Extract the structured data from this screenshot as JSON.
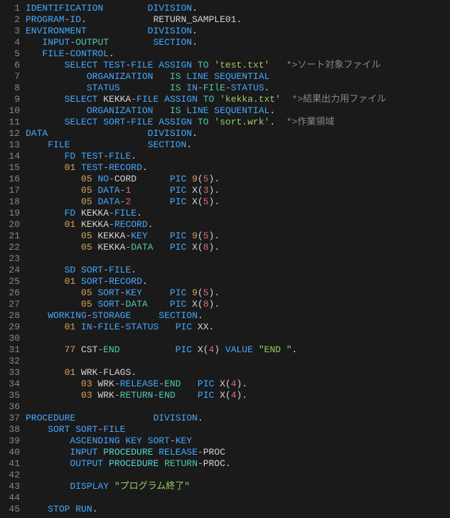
{
  "lines": [
    [
      [
        "kw",
        "IDENTIFICATION"
      ],
      [
        "pl",
        "        "
      ],
      [
        "kw",
        "DIVISION"
      ],
      [
        "pl",
        "."
      ]
    ],
    [
      [
        "kw",
        "PROGRAM"
      ],
      [
        "pk",
        "-"
      ],
      [
        "kw",
        "ID"
      ],
      [
        "pl",
        "."
      ],
      [
        "pl",
        "            RETURN_SAMPLE01."
      ]
    ],
    [
      [
        "kw",
        "ENVIRONMENT"
      ],
      [
        "pl",
        "           "
      ],
      [
        "kw",
        "DIVISION"
      ],
      [
        "pl",
        "."
      ]
    ],
    [
      [
        "kw",
        "   INPUT"
      ],
      [
        "pk",
        "-"
      ],
      [
        "teal",
        "OUTPUT"
      ],
      [
        "pl",
        "        "
      ],
      [
        "kw",
        "SECTION"
      ],
      [
        "pl",
        "."
      ]
    ],
    [
      [
        "kw",
        "   FILE"
      ],
      [
        "pk",
        "-"
      ],
      [
        "kw",
        "CONTROL"
      ],
      [
        "pl",
        "."
      ]
    ],
    [
      [
        "pl",
        "       "
      ],
      [
        "kw",
        "SELECT"
      ],
      [
        "pl",
        " "
      ],
      [
        "kw",
        "TEST"
      ],
      [
        "pk",
        "-"
      ],
      [
        "kw",
        "FILE "
      ],
      [
        "kw",
        "ASSIGN "
      ],
      [
        "teal",
        "TO"
      ],
      [
        "pl",
        " "
      ],
      [
        "str",
        "'test.txt'"
      ],
      [
        "pl",
        "   "
      ],
      [
        "cm",
        "*>ソート対象ファイル"
      ]
    ],
    [
      [
        "pl",
        "           "
      ],
      [
        "kw",
        "ORGANIZATION"
      ],
      [
        "pl",
        "   "
      ],
      [
        "teal",
        "IS"
      ],
      [
        "pl",
        " "
      ],
      [
        "kw",
        "LINE "
      ],
      [
        "kw",
        "SEQUENTIAL"
      ]
    ],
    [
      [
        "pl",
        "           "
      ],
      [
        "kw",
        "STATUS"
      ],
      [
        "pl",
        "         "
      ],
      [
        "teal",
        "IS"
      ],
      [
        "pl",
        " "
      ],
      [
        "kw",
        "IN"
      ],
      [
        "pk",
        "-"
      ],
      [
        "teal",
        "FIlE"
      ],
      [
        "pk",
        "-"
      ],
      [
        "kw",
        "STATUS"
      ],
      [
        "pl",
        "."
      ]
    ],
    [
      [
        "pl",
        "       "
      ],
      [
        "kw",
        "SELECT"
      ],
      [
        "pl",
        " KEKKA"
      ],
      [
        "pk",
        "-"
      ],
      [
        "kw",
        "FILE "
      ],
      [
        "kw",
        "ASSIGN "
      ],
      [
        "teal",
        "TO"
      ],
      [
        "pl",
        " "
      ],
      [
        "str",
        "'kekka.txt'"
      ],
      [
        "pl",
        "  "
      ],
      [
        "cm",
        "*>結果出力用ファイル"
      ]
    ],
    [
      [
        "pl",
        "           "
      ],
      [
        "kw",
        "ORGANIZATION"
      ],
      [
        "pl",
        "   "
      ],
      [
        "teal",
        "IS"
      ],
      [
        "pl",
        " "
      ],
      [
        "kw",
        "LINE "
      ],
      [
        "kw",
        "SEQUENTIAL"
      ],
      [
        "pl",
        "."
      ]
    ],
    [
      [
        "pl",
        "       "
      ],
      [
        "kw",
        "SELECT "
      ],
      [
        "kw",
        "SORT"
      ],
      [
        "pk",
        "-"
      ],
      [
        "kw",
        "FILE "
      ],
      [
        "kw",
        "ASSIGN "
      ],
      [
        "teal",
        "TO"
      ],
      [
        "pl",
        " "
      ],
      [
        "str",
        "'sort.wrk'"
      ],
      [
        "pl",
        ".  "
      ],
      [
        "cm",
        "*>作業領域"
      ]
    ],
    [
      [
        "kw",
        "DATA"
      ],
      [
        "pl",
        "                  "
      ],
      [
        "kw",
        "DIVISION"
      ],
      [
        "pl",
        "."
      ]
    ],
    [
      [
        "pl",
        "    "
      ],
      [
        "kw",
        "FILE"
      ],
      [
        "pl",
        "              "
      ],
      [
        "kw",
        "SECTION"
      ],
      [
        "pl",
        "."
      ]
    ],
    [
      [
        "pl",
        "       "
      ],
      [
        "kw",
        "FD "
      ],
      [
        "kw",
        "TEST"
      ],
      [
        "pk",
        "-"
      ],
      [
        "kw",
        "FILE"
      ],
      [
        "pl",
        "."
      ]
    ],
    [
      [
        "pl",
        "       "
      ],
      [
        "ol",
        "01"
      ],
      [
        "pl",
        " "
      ],
      [
        "kw",
        "TEST"
      ],
      [
        "pk",
        "-"
      ],
      [
        "kw",
        "RECORD"
      ],
      [
        "pl",
        "."
      ]
    ],
    [
      [
        "pl",
        "          "
      ],
      [
        "ol",
        "05"
      ],
      [
        "pl",
        " "
      ],
      [
        "kw",
        "NO"
      ],
      [
        "pk",
        "-"
      ],
      [
        "pl",
        "CORD      "
      ],
      [
        "kw",
        "PIC"
      ],
      [
        "pl",
        " "
      ],
      [
        "ol",
        "9"
      ],
      [
        "pl",
        "("
      ],
      [
        "num",
        "5"
      ],
      [
        "pl",
        ")."
      ]
    ],
    [
      [
        "pl",
        "          "
      ],
      [
        "ol",
        "05"
      ],
      [
        "pl",
        " "
      ],
      [
        "kw",
        "DATA"
      ],
      [
        "pk",
        "-"
      ],
      [
        "num",
        "1"
      ],
      [
        "pl",
        "       "
      ],
      [
        "kw",
        "PIC"
      ],
      [
        "pl",
        " X("
      ],
      [
        "num",
        "3"
      ],
      [
        "pl",
        ")."
      ]
    ],
    [
      [
        "pl",
        "          "
      ],
      [
        "ol",
        "05"
      ],
      [
        "pl",
        " "
      ],
      [
        "kw",
        "DATA"
      ],
      [
        "pk",
        "-"
      ],
      [
        "num",
        "2"
      ],
      [
        "pl",
        "       "
      ],
      [
        "kw",
        "PIC"
      ],
      [
        "pl",
        " X("
      ],
      [
        "num",
        "5"
      ],
      [
        "pl",
        ")."
      ]
    ],
    [
      [
        "pl",
        "       "
      ],
      [
        "kw",
        "FD"
      ],
      [
        "pl",
        " KEKKA"
      ],
      [
        "pk",
        "-"
      ],
      [
        "kw",
        "FILE"
      ],
      [
        "pl",
        "."
      ]
    ],
    [
      [
        "pl",
        "       "
      ],
      [
        "ol",
        "01"
      ],
      [
        "pl",
        " KEKKA"
      ],
      [
        "pk",
        "-"
      ],
      [
        "kw",
        "RECORD"
      ],
      [
        "pl",
        "."
      ]
    ],
    [
      [
        "pl",
        "          "
      ],
      [
        "ol",
        "05"
      ],
      [
        "pl",
        " KEKKA"
      ],
      [
        "pk",
        "-"
      ],
      [
        "kw",
        "KEY"
      ],
      [
        "pl",
        "    "
      ],
      [
        "kw",
        "PIC"
      ],
      [
        "pl",
        " "
      ],
      [
        "ol",
        "9"
      ],
      [
        "pl",
        "("
      ],
      [
        "num",
        "5"
      ],
      [
        "pl",
        ")."
      ]
    ],
    [
      [
        "pl",
        "          "
      ],
      [
        "ol",
        "05"
      ],
      [
        "pl",
        " KEKKA"
      ],
      [
        "pk",
        "-"
      ],
      [
        "teal",
        "DATA"
      ],
      [
        "pl",
        "   "
      ],
      [
        "kw",
        "PIC"
      ],
      [
        "pl",
        " X("
      ],
      [
        "num",
        "8"
      ],
      [
        "pl",
        ")."
      ]
    ],
    [
      [
        "pl",
        ""
      ]
    ],
    [
      [
        "pl",
        "       "
      ],
      [
        "kw",
        "SD "
      ],
      [
        "kw",
        "SORT"
      ],
      [
        "pk",
        "-"
      ],
      [
        "kw",
        "FILE"
      ],
      [
        "pl",
        "."
      ]
    ],
    [
      [
        "pl",
        "       "
      ],
      [
        "ol",
        "01"
      ],
      [
        "pl",
        " "
      ],
      [
        "kw",
        "SORT"
      ],
      [
        "pk",
        "-"
      ],
      [
        "kw",
        "RECORD"
      ],
      [
        "pl",
        "."
      ]
    ],
    [
      [
        "pl",
        "          "
      ],
      [
        "ol",
        "05"
      ],
      [
        "pl",
        " "
      ],
      [
        "kw",
        "SORT"
      ],
      [
        "pk",
        "-"
      ],
      [
        "kw",
        "KEY"
      ],
      [
        "pl",
        "     "
      ],
      [
        "kw",
        "PIC"
      ],
      [
        "pl",
        " "
      ],
      [
        "ol",
        "9"
      ],
      [
        "pl",
        "("
      ],
      [
        "num",
        "5"
      ],
      [
        "pl",
        ")."
      ]
    ],
    [
      [
        "pl",
        "          "
      ],
      [
        "ol",
        "05"
      ],
      [
        "pl",
        " "
      ],
      [
        "kw",
        "SORT"
      ],
      [
        "pk",
        "-"
      ],
      [
        "teal",
        "DATA"
      ],
      [
        "pl",
        "    "
      ],
      [
        "kw",
        "PIC"
      ],
      [
        "pl",
        " X("
      ],
      [
        "num",
        "8"
      ],
      [
        "pl",
        ")."
      ]
    ],
    [
      [
        "kw",
        "    WORKING"
      ],
      [
        "pk",
        "-"
      ],
      [
        "kw",
        "STORAGE"
      ],
      [
        "pl",
        "     "
      ],
      [
        "kw",
        "SECTION"
      ],
      [
        "pl",
        "."
      ]
    ],
    [
      [
        "pl",
        "       "
      ],
      [
        "ol",
        "01"
      ],
      [
        "pl",
        " "
      ],
      [
        "kw",
        "IN"
      ],
      [
        "pk",
        "-"
      ],
      [
        "kw",
        "FILE"
      ],
      [
        "pk",
        "-"
      ],
      [
        "kw",
        "STATUS"
      ],
      [
        "pl",
        "   "
      ],
      [
        "kw",
        "PIC"
      ],
      [
        "pl",
        " XX."
      ]
    ],
    [
      [
        "pl",
        ""
      ]
    ],
    [
      [
        "pl",
        "       "
      ],
      [
        "ol",
        "77"
      ],
      [
        "pl",
        " CST"
      ],
      [
        "pk",
        "-"
      ],
      [
        "teal",
        "END"
      ],
      [
        "pl",
        "          "
      ],
      [
        "kw",
        "PIC"
      ],
      [
        "pl",
        " X("
      ],
      [
        "num",
        "4"
      ],
      [
        "pl",
        ") "
      ],
      [
        "kw",
        "VALUE"
      ],
      [
        "pl",
        " "
      ],
      [
        "str",
        "\"END \""
      ],
      [
        "pl",
        "."
      ]
    ],
    [
      [
        "pl",
        ""
      ]
    ],
    [
      [
        "pl",
        "       "
      ],
      [
        "ol",
        "01"
      ],
      [
        "pl",
        " WRK"
      ],
      [
        "pk",
        "-"
      ],
      [
        "pl",
        "FLAGS."
      ]
    ],
    [
      [
        "pl",
        "          "
      ],
      [
        "ol",
        "03"
      ],
      [
        "pl",
        " WRK"
      ],
      [
        "pk",
        "-"
      ],
      [
        "kw",
        "RELEASE"
      ],
      [
        "pk",
        "-"
      ],
      [
        "teal",
        "END"
      ],
      [
        "pl",
        "   "
      ],
      [
        "kw",
        "PIC"
      ],
      [
        "pl",
        " X("
      ],
      [
        "num",
        "4"
      ],
      [
        "pl",
        ")."
      ]
    ],
    [
      [
        "pl",
        "          "
      ],
      [
        "ol",
        "03"
      ],
      [
        "pl",
        " WRK"
      ],
      [
        "pk",
        "-"
      ],
      [
        "teal",
        "RETURN"
      ],
      [
        "pk",
        "-"
      ],
      [
        "teal",
        "END"
      ],
      [
        "pl",
        "    "
      ],
      [
        "kw",
        "PIC"
      ],
      [
        "pl",
        " X("
      ],
      [
        "num",
        "4"
      ],
      [
        "pl",
        ")."
      ]
    ],
    [
      [
        "pl",
        ""
      ]
    ],
    [
      [
        "kw",
        "PROCEDURE"
      ],
      [
        "pl",
        "              "
      ],
      [
        "kw",
        "DIVISION"
      ],
      [
        "pl",
        "."
      ]
    ],
    [
      [
        "pl",
        "    "
      ],
      [
        "kw",
        "SORT "
      ],
      [
        "kw",
        "SORT"
      ],
      [
        "pk",
        "-"
      ],
      [
        "kw",
        "FILE"
      ]
    ],
    [
      [
        "pl",
        "        "
      ],
      [
        "kw",
        "ASCENDING "
      ],
      [
        "kw",
        "KEY "
      ],
      [
        "kw",
        "SORT"
      ],
      [
        "pk",
        "-"
      ],
      [
        "kw",
        "KEY"
      ]
    ],
    [
      [
        "pl",
        "        "
      ],
      [
        "kw",
        "INPUT "
      ],
      [
        "cy",
        "PROCEDURE"
      ],
      [
        "pl",
        " "
      ],
      [
        "kw",
        "RELEASE"
      ],
      [
        "pk",
        "-"
      ],
      [
        "pl",
        "PROC"
      ]
    ],
    [
      [
        "pl",
        "        "
      ],
      [
        "kw",
        "OUTPUT "
      ],
      [
        "cy",
        "PROCEDURE"
      ],
      [
        "pl",
        " "
      ],
      [
        "teal",
        "RETURN"
      ],
      [
        "pk",
        "-"
      ],
      [
        "pl",
        "PROC."
      ]
    ],
    [
      [
        "pl",
        ""
      ]
    ],
    [
      [
        "pl",
        "        "
      ],
      [
        "kw",
        "DISPLAY"
      ],
      [
        "pl",
        " "
      ],
      [
        "str",
        "\"プログラム終了\""
      ]
    ],
    [
      [
        "pl",
        ""
      ]
    ],
    [
      [
        "pl",
        "    "
      ],
      [
        "kw",
        "STOP "
      ],
      [
        "kw",
        "RUN"
      ],
      [
        "pl",
        "."
      ]
    ]
  ]
}
